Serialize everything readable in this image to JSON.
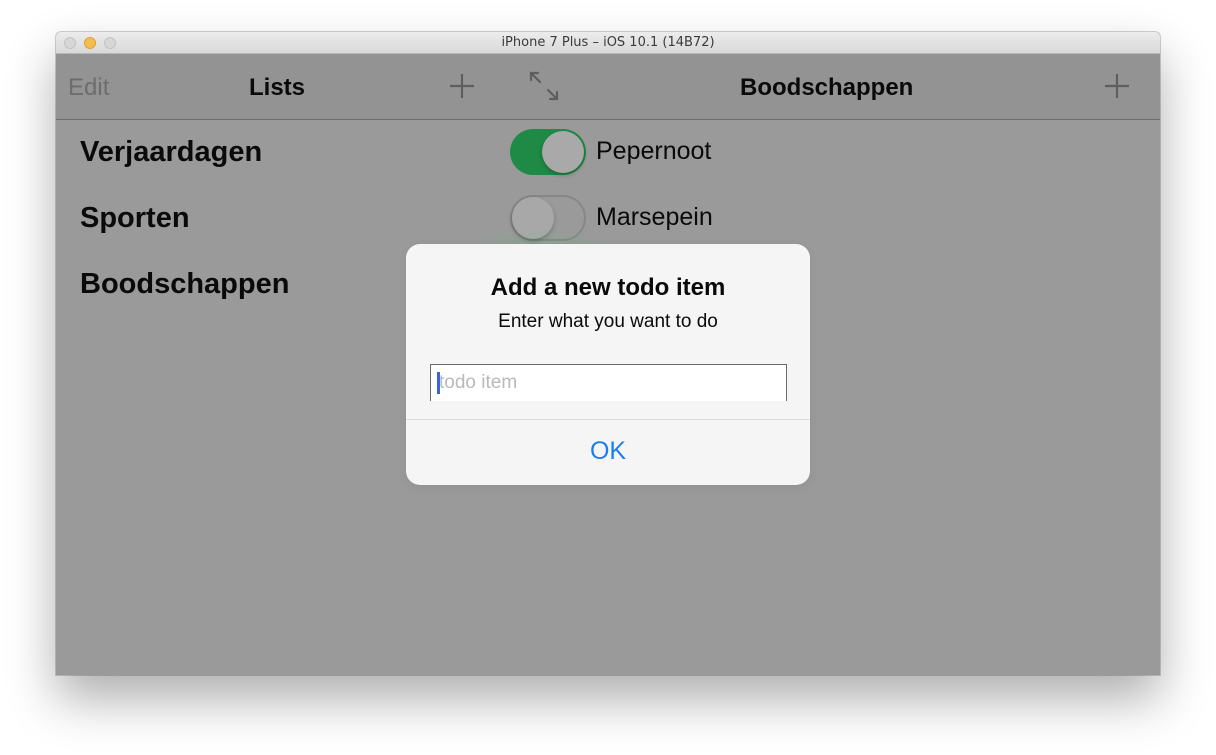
{
  "window": {
    "title": "iPhone 7 Plus – iOS 10.1 (14B72)"
  },
  "master": {
    "edit_label": "Edit",
    "title": "Lists",
    "add_icon": "plus-icon",
    "items": [
      {
        "label": "Verjaardagen"
      },
      {
        "label": "Sporten"
      },
      {
        "label": "Boodschappen"
      }
    ]
  },
  "detail": {
    "expand_icon": "expand-arrows-icon",
    "title": "Boodschappen",
    "add_icon": "plus-icon",
    "todos": [
      {
        "label": "Pepernoot",
        "done": true
      },
      {
        "label": "Marsepein",
        "done": false
      }
    ]
  },
  "alert": {
    "title": "Add a new todo item",
    "message": "Enter what you want to do",
    "input_value": "",
    "input_placeholder": "todo item",
    "ok_label": "OK"
  },
  "colors": {
    "accent": "#1a7ff0",
    "switch_on": "#1f8a45",
    "dim_overlay": "#9a9a9a"
  }
}
